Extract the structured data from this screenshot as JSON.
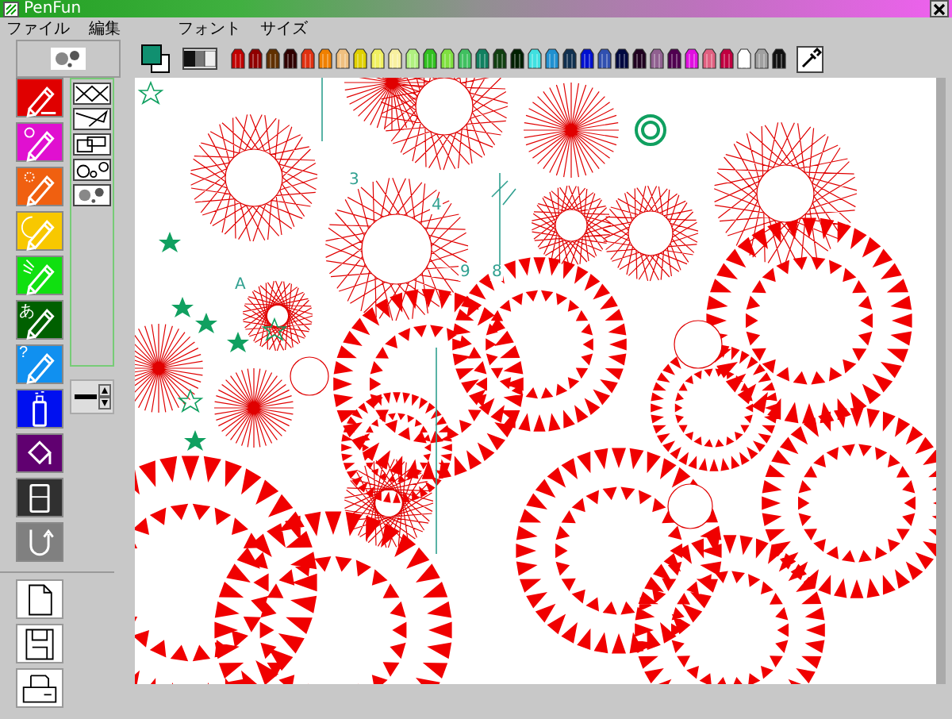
{
  "window": {
    "title": "PenFun"
  },
  "menu": [
    {
      "label": "ファイル"
    },
    {
      "label": "編集"
    },
    {
      "label": "フォント"
    },
    {
      "label": "サイズ"
    }
  ],
  "current_colors": [
    {
      "kind": "front",
      "color": "#109070"
    },
    {
      "kind": "back",
      "color": "#ffffff"
    }
  ],
  "palette": [
    {
      "color": "#c00000"
    },
    {
      "color": "#900000"
    },
    {
      "color": "#603000"
    },
    {
      "color": "#300000"
    },
    {
      "color": "#e03010"
    },
    {
      "color": "#f08000"
    },
    {
      "color": "#f0c080"
    },
    {
      "color": "#e0d000"
    },
    {
      "color": "#f0f060"
    },
    {
      "color": "#f8f0a0"
    },
    {
      "color": "#b0f080"
    },
    {
      "color": "#30c020"
    },
    {
      "color": "#80e040"
    },
    {
      "color": "#40c060"
    },
    {
      "color": "#108060"
    },
    {
      "color": "#104010"
    },
    {
      "color": "#002000"
    },
    {
      "color": "#40e0e0"
    },
    {
      "color": "#2090d0"
    },
    {
      "color": "#103050"
    },
    {
      "color": "#0010d0"
    },
    {
      "color": "#3050b0"
    },
    {
      "color": "#000840"
    },
    {
      "color": "#200020"
    },
    {
      "color": "#906090"
    },
    {
      "color": "#500050"
    },
    {
      "color": "#e010e0"
    },
    {
      "color": "#e06080"
    },
    {
      "color": "#c00040"
    },
    {
      "color": "#ffffff"
    },
    {
      "color": "#a0a0a0"
    },
    {
      "color": "#101010"
    }
  ],
  "tools": [
    {
      "kind": "pencil",
      "color": "#e00000"
    },
    {
      "kind": "flower",
      "color": "#e010d0"
    },
    {
      "kind": "dots",
      "color": "#f06010"
    },
    {
      "kind": "circle",
      "color": "#f8c800"
    },
    {
      "kind": "spark",
      "color": "#10e010"
    },
    {
      "kind": "text",
      "color": "#006000",
      "label": "あ"
    },
    {
      "kind": "text",
      "color": "#1090f0",
      "label": "?"
    },
    {
      "kind": "spray",
      "color": "#0010f0"
    },
    {
      "kind": "fill",
      "color": "#600070"
    },
    {
      "kind": "eraser",
      "color": "#303030"
    },
    {
      "kind": "undo",
      "color": "#808080"
    }
  ],
  "shapes": [
    {
      "kind": "lines"
    },
    {
      "kind": "polyline"
    },
    {
      "kind": "rects"
    },
    {
      "kind": "circles"
    },
    {
      "kind": "rosette"
    }
  ],
  "file_buttons": [
    {
      "kind": "new"
    },
    {
      "kind": "save"
    },
    {
      "kind": "print"
    }
  ],
  "canvas_labels": [
    {
      "text": "3"
    },
    {
      "text": "4"
    },
    {
      "text": "9"
    },
    {
      "text": "8"
    },
    {
      "text": "A"
    }
  ]
}
